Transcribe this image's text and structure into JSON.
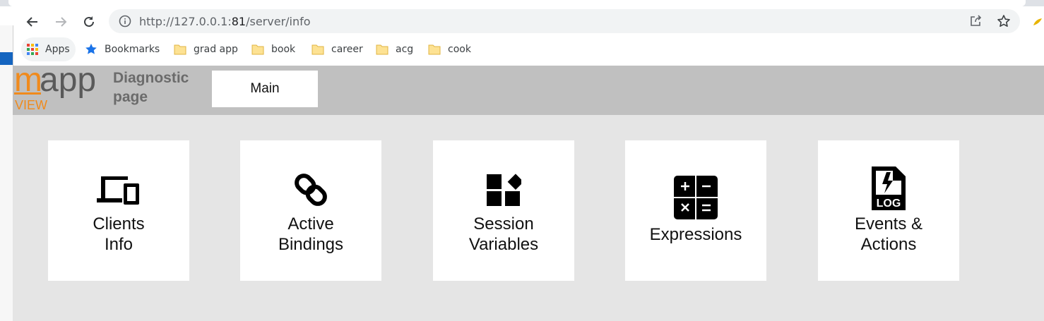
{
  "browser": {
    "url_host": "http://127.0.0.1:",
    "url_port": "81",
    "url_path": "/server/info"
  },
  "bookmarks": [
    {
      "label": "Apps"
    },
    {
      "label": "Bookmarks"
    },
    {
      "label": "grad app"
    },
    {
      "label": "book"
    },
    {
      "label": "career"
    },
    {
      "label": "acg"
    },
    {
      "label": "cook"
    }
  ],
  "app": {
    "logo_text": "mapp",
    "logo_sub": "VIEW",
    "diag_line1": "Diagnostic",
    "diag_line2": "page",
    "main_button": "Main",
    "colors": {
      "logo_orange": "#f08a1c",
      "logo_gray": "#5a5a5a",
      "header_bg": "#c0c0c0",
      "content_bg": "#e5e5e5"
    }
  },
  "tiles": [
    {
      "line1": "Clients",
      "line2": "Info",
      "icon": "devices-icon"
    },
    {
      "line1": "Active",
      "line2": "Bindings",
      "icon": "link-icon"
    },
    {
      "line1": "Session",
      "line2": "Variables",
      "icon": "widgets-icon"
    },
    {
      "line1": "Expressions",
      "line2": "",
      "icon": "calculator-icon"
    },
    {
      "line1": "Events &",
      "line2": "Actions",
      "icon": "log-file-icon"
    }
  ]
}
